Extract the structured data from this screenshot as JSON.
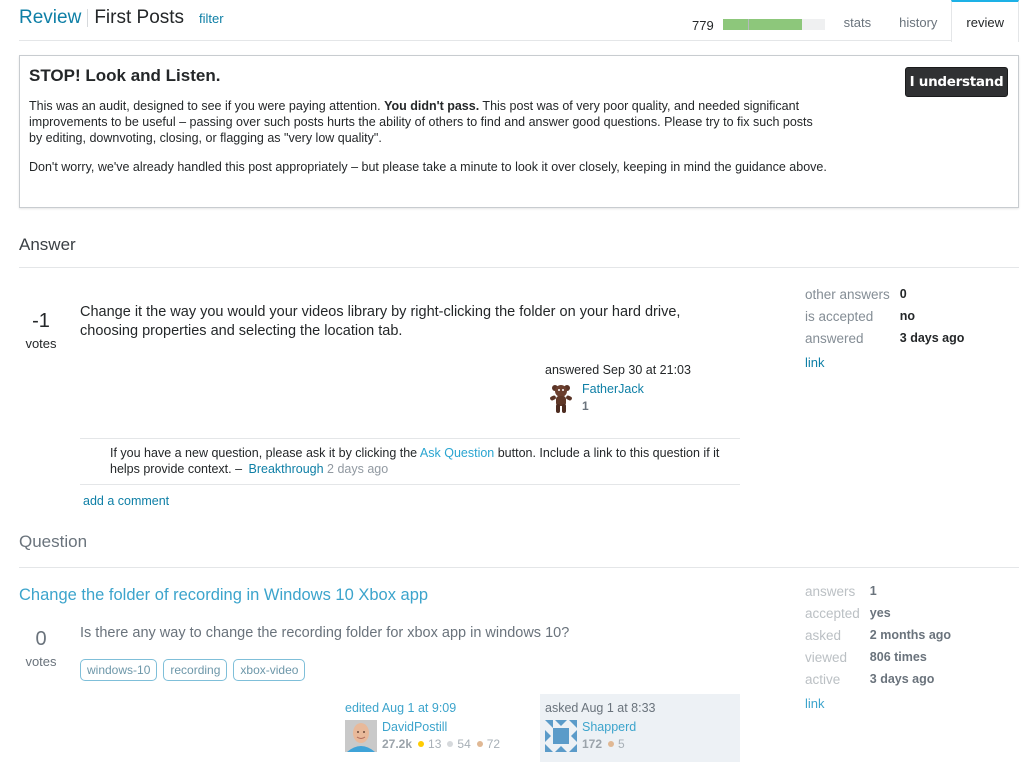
{
  "header": {
    "review_label": "Review",
    "queue_title": "First Posts",
    "filter_label": "filter",
    "review_count": "779",
    "progress_percent": 77,
    "tabs": [
      {
        "label": "stats",
        "active": false
      },
      {
        "label": "history",
        "active": false
      },
      {
        "label": "review",
        "active": true
      }
    ]
  },
  "audit": {
    "title": "STOP! Look and Listen.",
    "p1_start": "This was an audit, designed to see if you were paying attention. ",
    "p1_bold": "You didn't pass.",
    "p1_end": " This post was of very poor quality, and needed significant improvements to be useful – passing over such posts hurts the ability of others to find and answer good questions. Please try to fix such posts by editing, downvoting, closing, or flagging as \"very low quality\".",
    "p2": "Don't worry, we've already handled this post appropriately – but please take a minute to look it over closely, keeping in mind the guidance above.",
    "button_label": "I understand"
  },
  "answer": {
    "section_title": "Answer",
    "votes": "-1",
    "votes_label": "votes",
    "body": "Change it the way you would your videos library by right-clicking the folder on your hard drive, choosing properties and selecting the location tab.",
    "signature": {
      "action": "answered Sep 30 at 21:03",
      "user": "FatherJack",
      "reputation": "1",
      "avatar_icon": "teddy-bear-avatar"
    },
    "comment": {
      "text_before": "If you have a new question, please ask it by clicking the ",
      "link_text": "Ask Question",
      "text_after": " button. Include a link to this question if it helps provide context. – ",
      "user": "Breakthrough",
      "time": "2 days ago"
    },
    "add_comment_label": "add a comment",
    "stats": [
      {
        "key": "other answers",
        "value": "0"
      },
      {
        "key": "is accepted",
        "value": "no"
      },
      {
        "key": "answered",
        "value": "3 days ago"
      }
    ],
    "link_label": "link"
  },
  "question": {
    "section_title": "Question",
    "title": "Change the folder of recording in Windows 10 Xbox app",
    "votes": "0",
    "votes_label": "votes",
    "body": "Is there any way to change the recording folder for xbox app in windows 10?",
    "tags": [
      "windows-10",
      "recording",
      "xbox-video"
    ],
    "editor": {
      "action": "edited Aug 1 at 9:09",
      "user": "DavidPostill",
      "reputation": "27.2k",
      "gold": "13",
      "silver": "54",
      "bronze": "72"
    },
    "asker": {
      "action": "asked Aug 1 at 8:33",
      "user": "Shapperd",
      "reputation": "172",
      "bronze": "5"
    },
    "stats": [
      {
        "key": "answers",
        "value": "1"
      },
      {
        "key": "accepted",
        "value": "yes"
      },
      {
        "key": "asked",
        "value": "2 months ago"
      },
      {
        "key": "viewed",
        "value": "806 times"
      },
      {
        "key": "active",
        "value": "3 days ago"
      }
    ],
    "link_label": "link"
  },
  "colors": {
    "accent_link": "#0e7fa6",
    "progress_fill": "#8dc77b",
    "active_tab_border": "#1db1e6",
    "badge_gold": "#ffcc01",
    "badge_silver": "#b4b8bc",
    "badge_bronze": "#d1a684"
  }
}
